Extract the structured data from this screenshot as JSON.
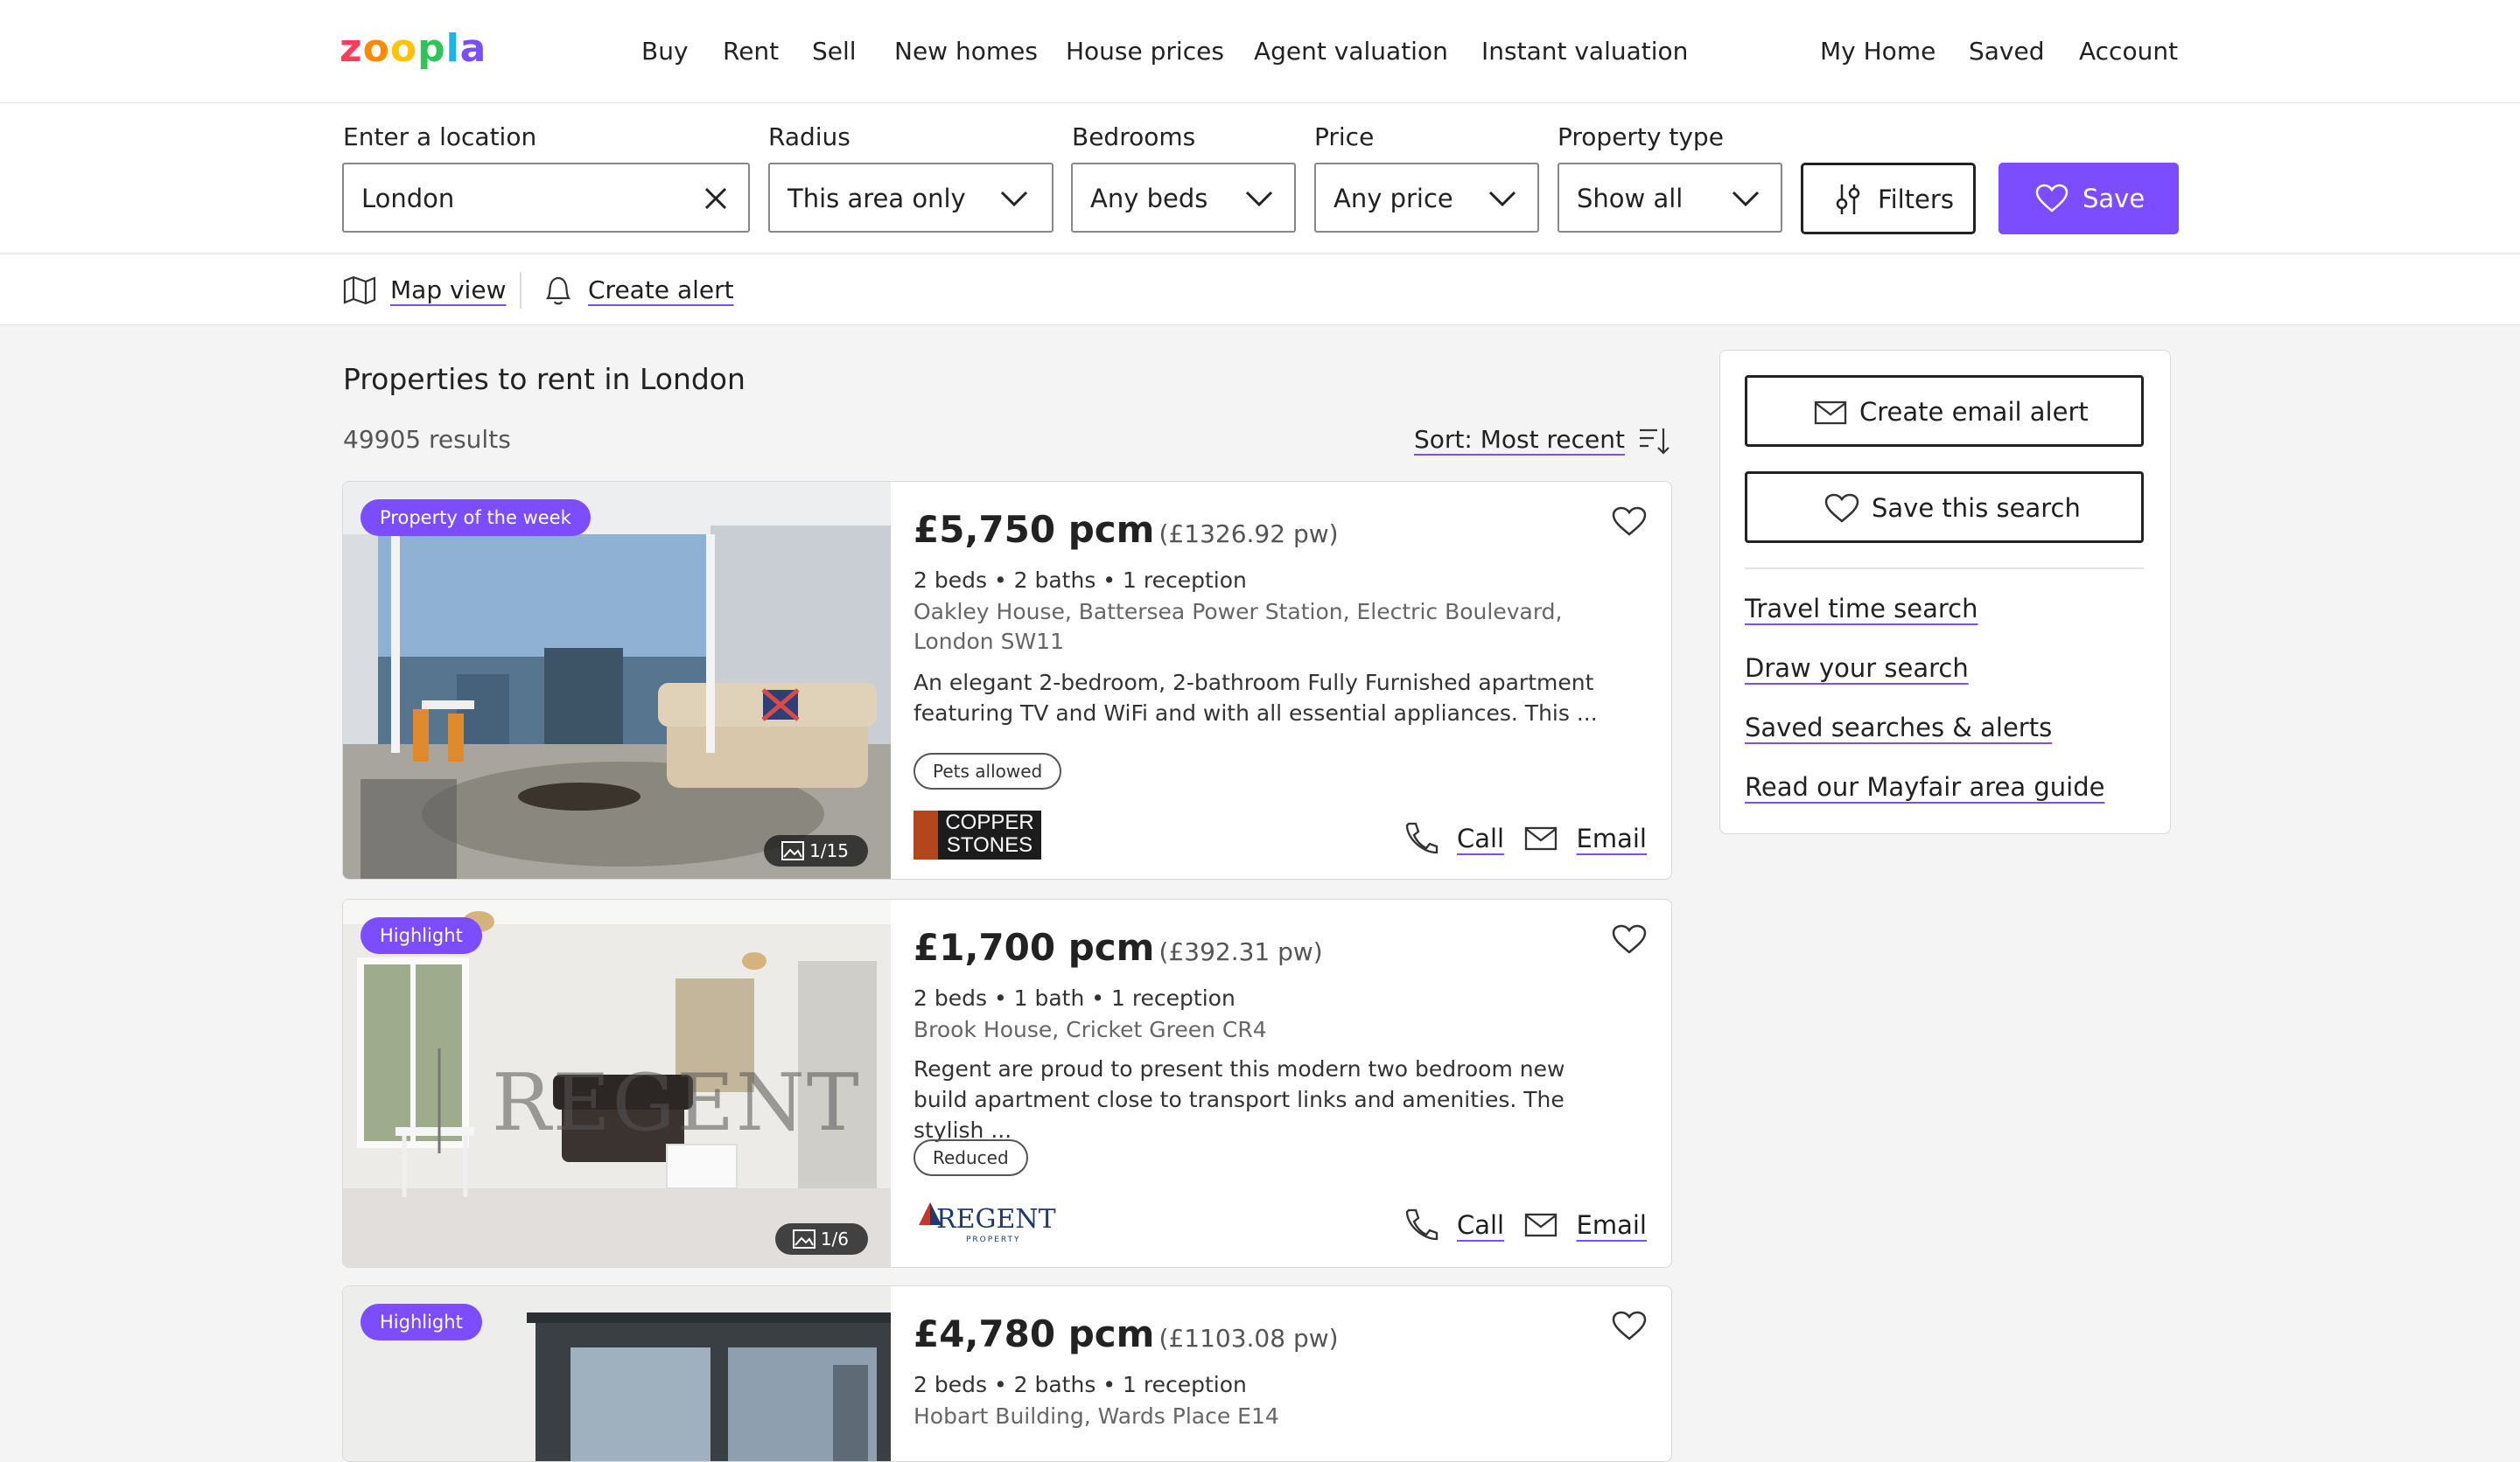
{
  "header": {
    "logo": "zoopla",
    "nav": [
      "Buy",
      "Rent",
      "Sell",
      "New homes",
      "House prices",
      "Agent valuation",
      "Instant valuation"
    ],
    "right_nav": [
      "My Home",
      "Saved",
      "Account"
    ]
  },
  "search": {
    "location_label": "Enter a location",
    "location_value": "London",
    "radius_label": "Radius",
    "radius_value": "This area only",
    "bedrooms_label": "Bedrooms",
    "bedrooms_value": "Any beds",
    "price_label": "Price",
    "price_value": "Any price",
    "type_label": "Property type",
    "type_value": "Show all",
    "filters_label": "Filters",
    "save_label": "Save"
  },
  "subbar": {
    "map_view": "Map view",
    "create_alert": "Create alert"
  },
  "results": {
    "title": "Properties to rent in London",
    "count": "49905 results",
    "sort_label": "Sort: Most recent"
  },
  "listings": [
    {
      "badge": "Property of the week",
      "photo_counter": "1/15",
      "price": "£5,750 pcm",
      "price_pw": "(£1326.92 pw)",
      "specs": "2 beds • 2 baths • 1 reception",
      "address": "Oakley House, Battersea Power Station, Electric Boulevard, London SW11",
      "description": "An elegant 2-bedroom, 2-bathroom Fully Furnished apartment featuring TV and WiFi and with all essential appliances. This ...",
      "tag": "Pets allowed",
      "agent": "COPPER STONES",
      "call_label": "Call",
      "email_label": "Email"
    },
    {
      "badge": "Highlight",
      "photo_counter": "1/6",
      "price": "£1,700 pcm",
      "price_pw": "(£392.31 pw)",
      "specs": "2 beds • 1 bath • 1 reception",
      "address": "Brook House, Cricket Green CR4",
      "description": "Regent are proud to present this modern two bedroom new build apartment close to transport links and amenities. The stylish ...",
      "tag": "Reduced",
      "agent": "REGENT",
      "agent_sub": "PROPERTY",
      "watermark": "REGENT",
      "call_label": "Call",
      "email_label": "Email"
    },
    {
      "badge": "Highlight",
      "price": "£4,780 pcm",
      "price_pw": "(£1103.08 pw)",
      "specs": "2 beds • 2 baths • 1 reception",
      "address": "Hobart Building, Wards Place E14"
    }
  ],
  "sidebar": {
    "email_alert": "Create email alert",
    "save_search": "Save this search",
    "links": [
      "Travel time search",
      "Draw your search",
      "Saved searches & alerts",
      "Read our Mayfair area guide"
    ]
  },
  "colors": {
    "accent": "#7c4dff",
    "text": "#1f1f1f",
    "background": "#f4f4f4"
  }
}
